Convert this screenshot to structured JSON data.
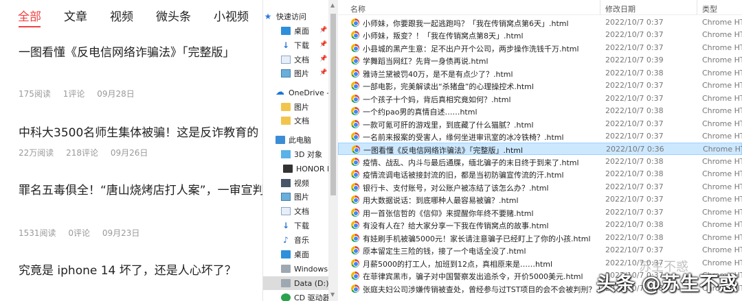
{
  "feed": {
    "tabs": [
      "全部",
      "文章",
      "视频",
      "微头条",
      "小视频"
    ],
    "articles": [
      {
        "title": "一图看懂《反电信网络诈骗法》「完整版」",
        "reads": "175阅读",
        "comments": "1评论",
        "date": "09月28日"
      },
      {
        "title": "中科大3500名师生集体被骗！这是反诈教育的",
        "reads": "22万阅读",
        "comments": "218评论",
        "date": "09月26日"
      },
      {
        "title": "罪名五毒俱全！“唐山烧烤店打人案”，一审宣判",
        "reads": "1531阅读",
        "comments": "0评论",
        "date": "09月23日"
      },
      {
        "title": "究竟是 iphone 14 坏了，还是人心坏了？",
        "reads": "",
        "comments": "",
        "date": ""
      }
    ]
  },
  "nav": {
    "items": [
      {
        "label": "快速访问",
        "icon": "star-icon",
        "pinned": false
      },
      {
        "label": "桌面",
        "icon": "desktop-icon",
        "pinned": true
      },
      {
        "label": "下载",
        "icon": "download-icon",
        "pinned": true
      },
      {
        "label": "文档",
        "icon": "document-icon",
        "pinned": true
      },
      {
        "label": "图片",
        "icon": "picture-icon",
        "pinned": true
      },
      {
        "label": "OneDrive -",
        "icon": "cloud-icon",
        "pinned": false
      },
      {
        "label": "图片",
        "icon": "folder-icon",
        "pinned": false
      },
      {
        "label": "文档",
        "icon": "folder-icon",
        "pinned": false
      },
      {
        "label": "此电脑",
        "icon": "computer-icon",
        "pinned": false
      },
      {
        "label": "3D 对象",
        "icon": "cube-icon",
        "pinned": false
      },
      {
        "label": "HONOR P",
        "icon": "phone-icon",
        "pinned": false
      },
      {
        "label": "视频",
        "icon": "video-icon",
        "pinned": false
      },
      {
        "label": "图片",
        "icon": "picture-icon",
        "pinned": false
      },
      {
        "label": "文档",
        "icon": "document-icon",
        "pinned": false
      },
      {
        "label": "下载",
        "icon": "download-icon",
        "pinned": false
      },
      {
        "label": "音乐",
        "icon": "music-icon",
        "pinned": false
      },
      {
        "label": "桌面",
        "icon": "desktop-icon",
        "pinned": false
      },
      {
        "label": "Windows-",
        "icon": "drive-icon",
        "pinned": false
      },
      {
        "label": "Data (D:)",
        "icon": "drive-icon",
        "pinned": false
      },
      {
        "label": "CD 驱动器",
        "icon": "cd-icon",
        "pinned": false
      }
    ]
  },
  "files": {
    "columns": {
      "name": "名称",
      "date": "修改日期",
      "type": "类型"
    },
    "rows": [
      {
        "name": "小师妹，你要跟我一起逃跑吗？「我在传销窝点第6天」.html",
        "date": "2022/10/7 0:37",
        "type": "Chrome HTML"
      },
      {
        "name": "小师妹，叛变？！「我在传销窝点第8天」.html",
        "date": "2022/10/7 0:37",
        "type": "Chrome HTML"
      },
      {
        "name": "小县城的黑产生意：足不出户开个公司，两步操作洗钱千万.html",
        "date": "2022/10/7 0:37",
        "type": "Chrome HTML"
      },
      {
        "name": "学舞蹈当网红？先背一身债再说.html",
        "date": "2022/10/7 0:39",
        "type": "Chrome HTML"
      },
      {
        "name": "雅诗兰黛被罚40万，是不是有点少了？.html",
        "date": "2022/10/7 0:38",
        "type": "Chrome HTML"
      },
      {
        "name": "一部电影，完美解读出“杀猪盘”的心理操控术.html",
        "date": "2022/10/7 0:37",
        "type": "Chrome HTML"
      },
      {
        "name": "一个孩子十个妈，背后真相究竟如何？.html",
        "date": "2022/10/7 0:37",
        "type": "Chrome HTML"
      },
      {
        "name": "一个约pao男的真情自述……html",
        "date": "2022/10/7 0:38",
        "type": "Chrome HTML"
      },
      {
        "name": "一款可氪可肝的游戏里，到底藏了什么猫腻？.html",
        "date": "2022/10/7 0:37",
        "type": "Chrome HTML"
      },
      {
        "name": "一名前来报案的受害人，缘何坐进审讯室的冰冷铁椅？.html",
        "date": "2022/10/7 0:37",
        "type": "Chrome HTML"
      },
      {
        "name": "一图看懂《反电信网络诈骗法》「完整版」.html",
        "date": "2022/10/7 0:36",
        "type": "Chrome HTML",
        "selected": true
      },
      {
        "name": "疫情、战乱、内斗与最后通牒，缅北骗子的末日终于到来了.html",
        "date": "2022/10/7 0:38",
        "type": "Chrome HTML"
      },
      {
        "name": "疫情流调电话被接封流的旧，都是当初防骗宣传流的汗.html",
        "date": "2022/10/7 0:38",
        "type": "Chrome HTML"
      },
      {
        "name": "银行卡、支付账号，对公账户被冻结了该怎么办？.html",
        "date": "2022/10/7 0:37",
        "type": "Chrome HTML"
      },
      {
        "name": "用大数据说话：到底哪种人最容易被骗？.html",
        "date": "2022/10/7 0:37",
        "type": "Chrome HTML"
      },
      {
        "name": "用一首张信哲的《信仰》来提醒你年终不要赌.html",
        "date": "2022/10/7 0:37",
        "type": "Chrome HTML"
      },
      {
        "name": "有没有人在？给大家分享一下我在传销窝点的故事.html",
        "date": "2022/10/7 0:38",
        "type": "Chrome HTML"
      },
      {
        "name": "有娃刷手机被骗5000元！家长请注意骗子已经盯上了你的小孩.html",
        "date": "2022/10/7 0:38",
        "type": "Chrome HTML"
      },
      {
        "name": "原本留定生三险的钱，接了一个电话全没了.html",
        "date": "2022/10/7 0:37",
        "type": "Chrome HTML"
      },
      {
        "name": "月薪5000的打工人，加班到12点，真相原来是……html",
        "date": "2022/10/7 0:37",
        "type": "Chrome HTML"
      },
      {
        "name": "在菲律宾黑市，骗子对中国警察发出追杀令，开价5000美元.html",
        "date": "2022/10/7 0:37",
        "type": "Chrome HTML"
      },
      {
        "name": "张庭夫妇公司涉嫌传销被查处，曾经参与过TST项目的会不会被判刑？.html",
        "date": "2022/10/7 0:38",
        "type": "Chrome HTML"
      }
    ]
  },
  "watermark": {
    "ghost": "苏生不惑",
    "main": "头条 @苏生不惑"
  },
  "colors": {
    "accent": "#f04142",
    "selection": "#cce8ff",
    "folder": "#f1c54d"
  }
}
